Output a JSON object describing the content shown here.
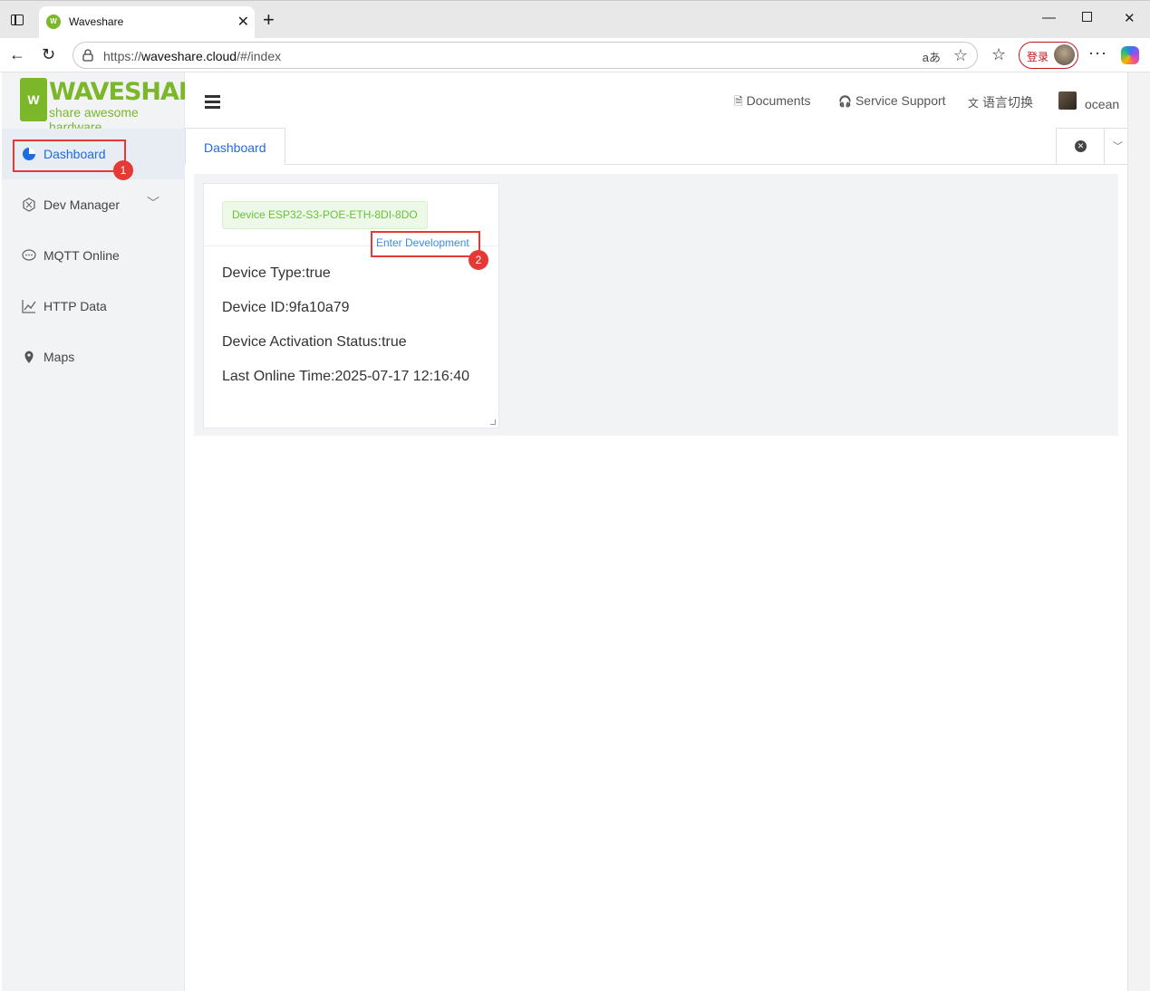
{
  "browser": {
    "tab_title": "Waveshare",
    "url_prefix": "https://",
    "url_host": "waveshare.cloud",
    "url_path": "/#/index",
    "login_label": "登录",
    "read_aloud": "aあ"
  },
  "logo": {
    "wordmark": "WAVESHARE",
    "tagline": "share awesome hardware",
    "mark": "W"
  },
  "sidebar": {
    "items": [
      {
        "label": "Dashboard",
        "icon": "pie-chart-icon"
      },
      {
        "label": "Dev Manager",
        "icon": "hexagon-icon"
      },
      {
        "label": "MQTT Online",
        "icon": "chat-icon"
      },
      {
        "label": "HTTP Data",
        "icon": "line-chart-icon"
      },
      {
        "label": "Maps",
        "icon": "map-pin-icon"
      }
    ]
  },
  "header": {
    "documents": "Documents",
    "service_support": "Service Support",
    "language": "语言切换",
    "user": "ocean"
  },
  "tabs": {
    "active": "Dashboard"
  },
  "card": {
    "device_tag": "Device ESP32-S3-POE-ETH-8DI-8DO",
    "enter_label": "Enter Development",
    "device_type": "Device Type:true",
    "device_id": "Device ID:9fa10a79",
    "activation": "Device Activation Status:true",
    "last_online": "Last Online Time:2025-07-17 12:16:40"
  },
  "annotations": {
    "badge1": "1",
    "badge2": "2",
    "highlight_color": "#e53935"
  },
  "colors": {
    "brand": "#7bb728",
    "accent": "#1f6ce0",
    "success": "#67c23a"
  }
}
